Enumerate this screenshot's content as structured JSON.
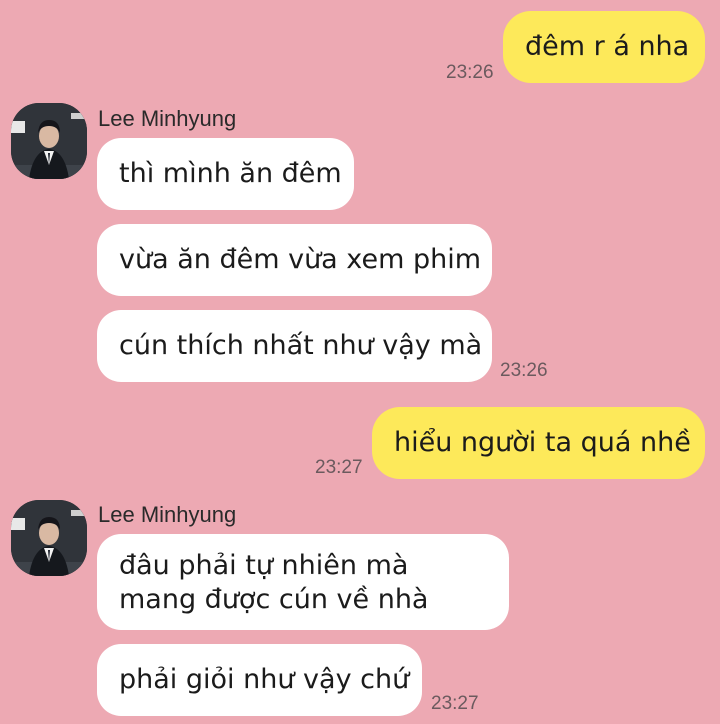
{
  "messages": [
    {
      "sender": "me",
      "text": "đêm r á nha",
      "time": "23:26"
    },
    {
      "sender": "Lee Minhyung",
      "texts": [
        "thì mình ăn đêm",
        "vừa ăn đêm vừa xem phim",
        "cún thích nhất như vậy mà"
      ],
      "time": "23:26"
    },
    {
      "sender": "me",
      "text": "hiểu người ta quá nhề",
      "time": "23:27"
    },
    {
      "sender": "Lee Minhyung",
      "texts": [
        "đâu phải tự nhiên mà mang được cún về nhà",
        "phải giỏi như vậy chứ"
      ],
      "time": "23:27"
    }
  ],
  "contact": {
    "name": "Lee Minhyung",
    "avatar_icon": "profile-photo-avatar"
  },
  "colors": {
    "background": "#eda9b3",
    "my_bubble": "#fde95a",
    "their_bubble": "#ffffff"
  }
}
